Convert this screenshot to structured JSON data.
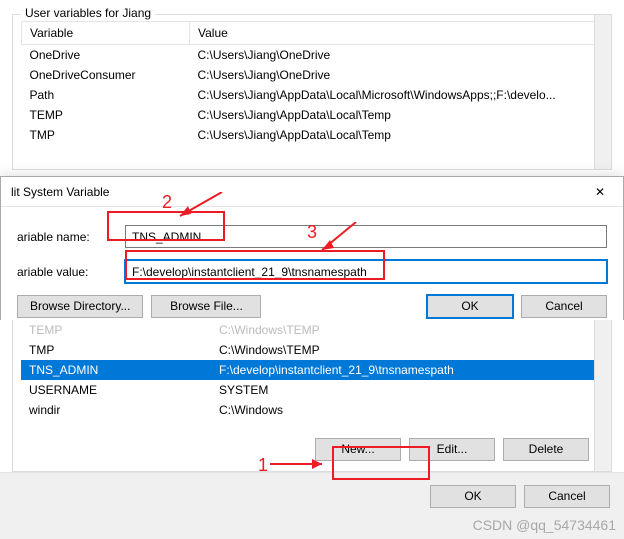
{
  "top": {
    "group_title": "User variables for Jiang",
    "headers": {
      "var": "Variable",
      "val": "Value"
    },
    "rows": [
      {
        "var": "OneDrive",
        "val": "C:\\Users\\Jiang\\OneDrive"
      },
      {
        "var": "OneDriveConsumer",
        "val": "C:\\Users\\Jiang\\OneDrive"
      },
      {
        "var": "Path",
        "val": "C:\\Users\\Jiang\\AppData\\Local\\Microsoft\\WindowsApps;;F:\\develo..."
      },
      {
        "var": "TEMP",
        "val": "C:\\Users\\Jiang\\AppData\\Local\\Temp"
      },
      {
        "var": "TMP",
        "val": "C:\\Users\\Jiang\\AppData\\Local\\Temp"
      }
    ]
  },
  "dialog": {
    "title": "lit System Variable",
    "name_label": "ariable name:",
    "value_label": "ariable value:",
    "name_input": "TNS_ADMIN",
    "value_input": "F:\\develop\\instantclient_21_9\\tnsnamespath",
    "browse_dir": "Browse Directory...",
    "browse_file": "Browse File...",
    "ok": "OK",
    "cancel": "Cancel"
  },
  "lower": {
    "rows": [
      {
        "var": "TEMP",
        "val": "C:\\Windows\\TEMP"
      },
      {
        "var": "TMP",
        "val": "C:\\Windows\\TEMP"
      },
      {
        "var": "TNS_ADMIN",
        "val": "F:\\develop\\instantclient_21_9\\tnsnamespath",
        "sel": true
      },
      {
        "var": "USERNAME",
        "val": "SYSTEM"
      },
      {
        "var": "windir",
        "val": "C:\\Windows"
      }
    ],
    "new": "New...",
    "edit": "Edit...",
    "delete": "Delete"
  },
  "footer": {
    "ok": "OK",
    "cancel": "Cancel"
  },
  "annot": {
    "n1": "1",
    "n2": "2",
    "n3": "3"
  },
  "watermark": "CSDN @qq_54734461"
}
